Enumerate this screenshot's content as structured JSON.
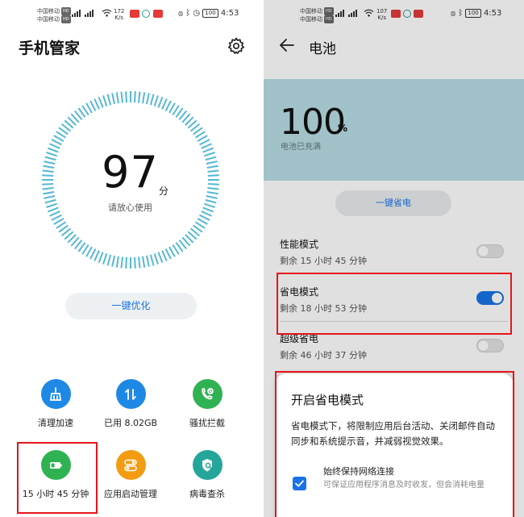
{
  "statusbar": {
    "carrier_1": "中国移动",
    "carrier_2": "中国移动",
    "hd": "HD",
    "left_speed_value": "172",
    "right_speed_value": "107",
    "speed_unit": "K/s",
    "battery": "100",
    "time": "4:53"
  },
  "manager": {
    "title": "手机管家",
    "score": "97",
    "score_unit": "分",
    "score_caption": "请放心使用",
    "optimize_label": "一键优化",
    "tools": [
      {
        "label": "清理加速",
        "icon": "broom-icon",
        "color": "#1e88e5"
      },
      {
        "label": "已用 8.02GB",
        "icon": "data-arrows-icon",
        "color": "#1e88e5"
      },
      {
        "label": "骚扰拦截",
        "icon": "phone-block-icon",
        "color": "#2fb352"
      },
      {
        "label": "15 小时 45 分钟",
        "icon": "battery-icon",
        "color": "#2fb352"
      },
      {
        "label": "应用启动管理",
        "icon": "toggle-icon",
        "color": "#f39c12"
      },
      {
        "label": "病毒查杀",
        "icon": "shield-scan-icon",
        "color": "#26a69a"
      }
    ]
  },
  "battery": {
    "title": "电池",
    "percent": "100",
    "percent_symbol": "%",
    "status": "电池已充满",
    "save_label": "一键省电",
    "modes": [
      {
        "title": "性能模式",
        "remaining": "剩余 15 小时 45 分钟",
        "on": false
      },
      {
        "title": "省电模式",
        "remaining": "剩余 18 小时 53 分钟",
        "on": true
      },
      {
        "title": "超级省电",
        "remaining": "剩余 46 小时 37 分钟",
        "on": false
      }
    ]
  },
  "sheet": {
    "title": "开启省电模式",
    "description": "省电模式下，将限制应用后台活动、关闭邮件自动同步和系统提示音，并减弱视觉效果。",
    "option_title": "始终保持网络连接",
    "option_desc": "可保证应用程序消息及时收发，但会消耗电量",
    "option_checked": true
  },
  "colors": {
    "accent": "#1a73e8",
    "dial": "#55b8d4",
    "highlight": "#e4161b",
    "hero": "#b8dde4"
  }
}
